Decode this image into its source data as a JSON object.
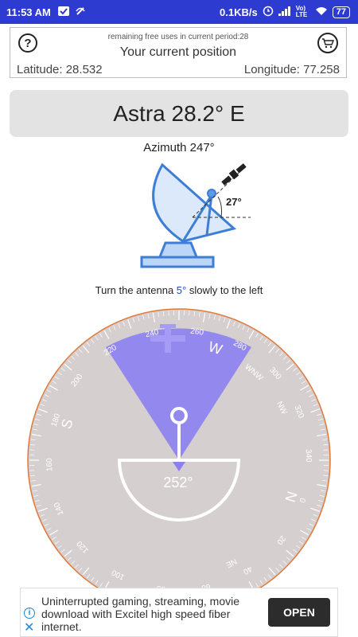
{
  "status_bar": {
    "time": "11:53 AM",
    "net_speed": "0.1KB/s",
    "lte_label": "Vo) LTE",
    "battery": "77",
    "icons": [
      "shield-check-icon",
      "muted-notification-icon",
      "alarm-icon",
      "signal-icon",
      "wifi-icon",
      "battery-icon"
    ]
  },
  "position": {
    "remaining": "remaining free uses in current period:28",
    "title": "Your current position",
    "latitude": "Latitude: 28.532",
    "longitude": "Longitude: 77.258",
    "help_icon": "?"
  },
  "satellite": {
    "name": "Astra 28.2° E"
  },
  "azimuth": {
    "label": "Azimuth 247°"
  },
  "dish": {
    "elevation_label": "27°"
  },
  "instruction": {
    "prefix": "Turn the antenna ",
    "degrees": "5°",
    "suffix": " slowly to the left"
  },
  "compass": {
    "heading_label": "252°",
    "direction_labels": [
      "N",
      "NW",
      "WNW",
      "W",
      "S",
      "NE"
    ],
    "tick_labels": [
      "240",
      "260",
      "280",
      "300",
      "320",
      "340",
      "0",
      "20",
      "40",
      "60",
      "80",
      "100",
      "120",
      "140",
      "160",
      "180",
      "200",
      "220"
    ],
    "colors": {
      "dial": "#d6cfcf",
      "beam": "#8c7ff0",
      "arc": "#e07a3a"
    }
  },
  "ad": {
    "text": "Uninterrupted gaming, streaming, movie download with Excitel high speed fiber internet.",
    "cta": "OPEN"
  }
}
